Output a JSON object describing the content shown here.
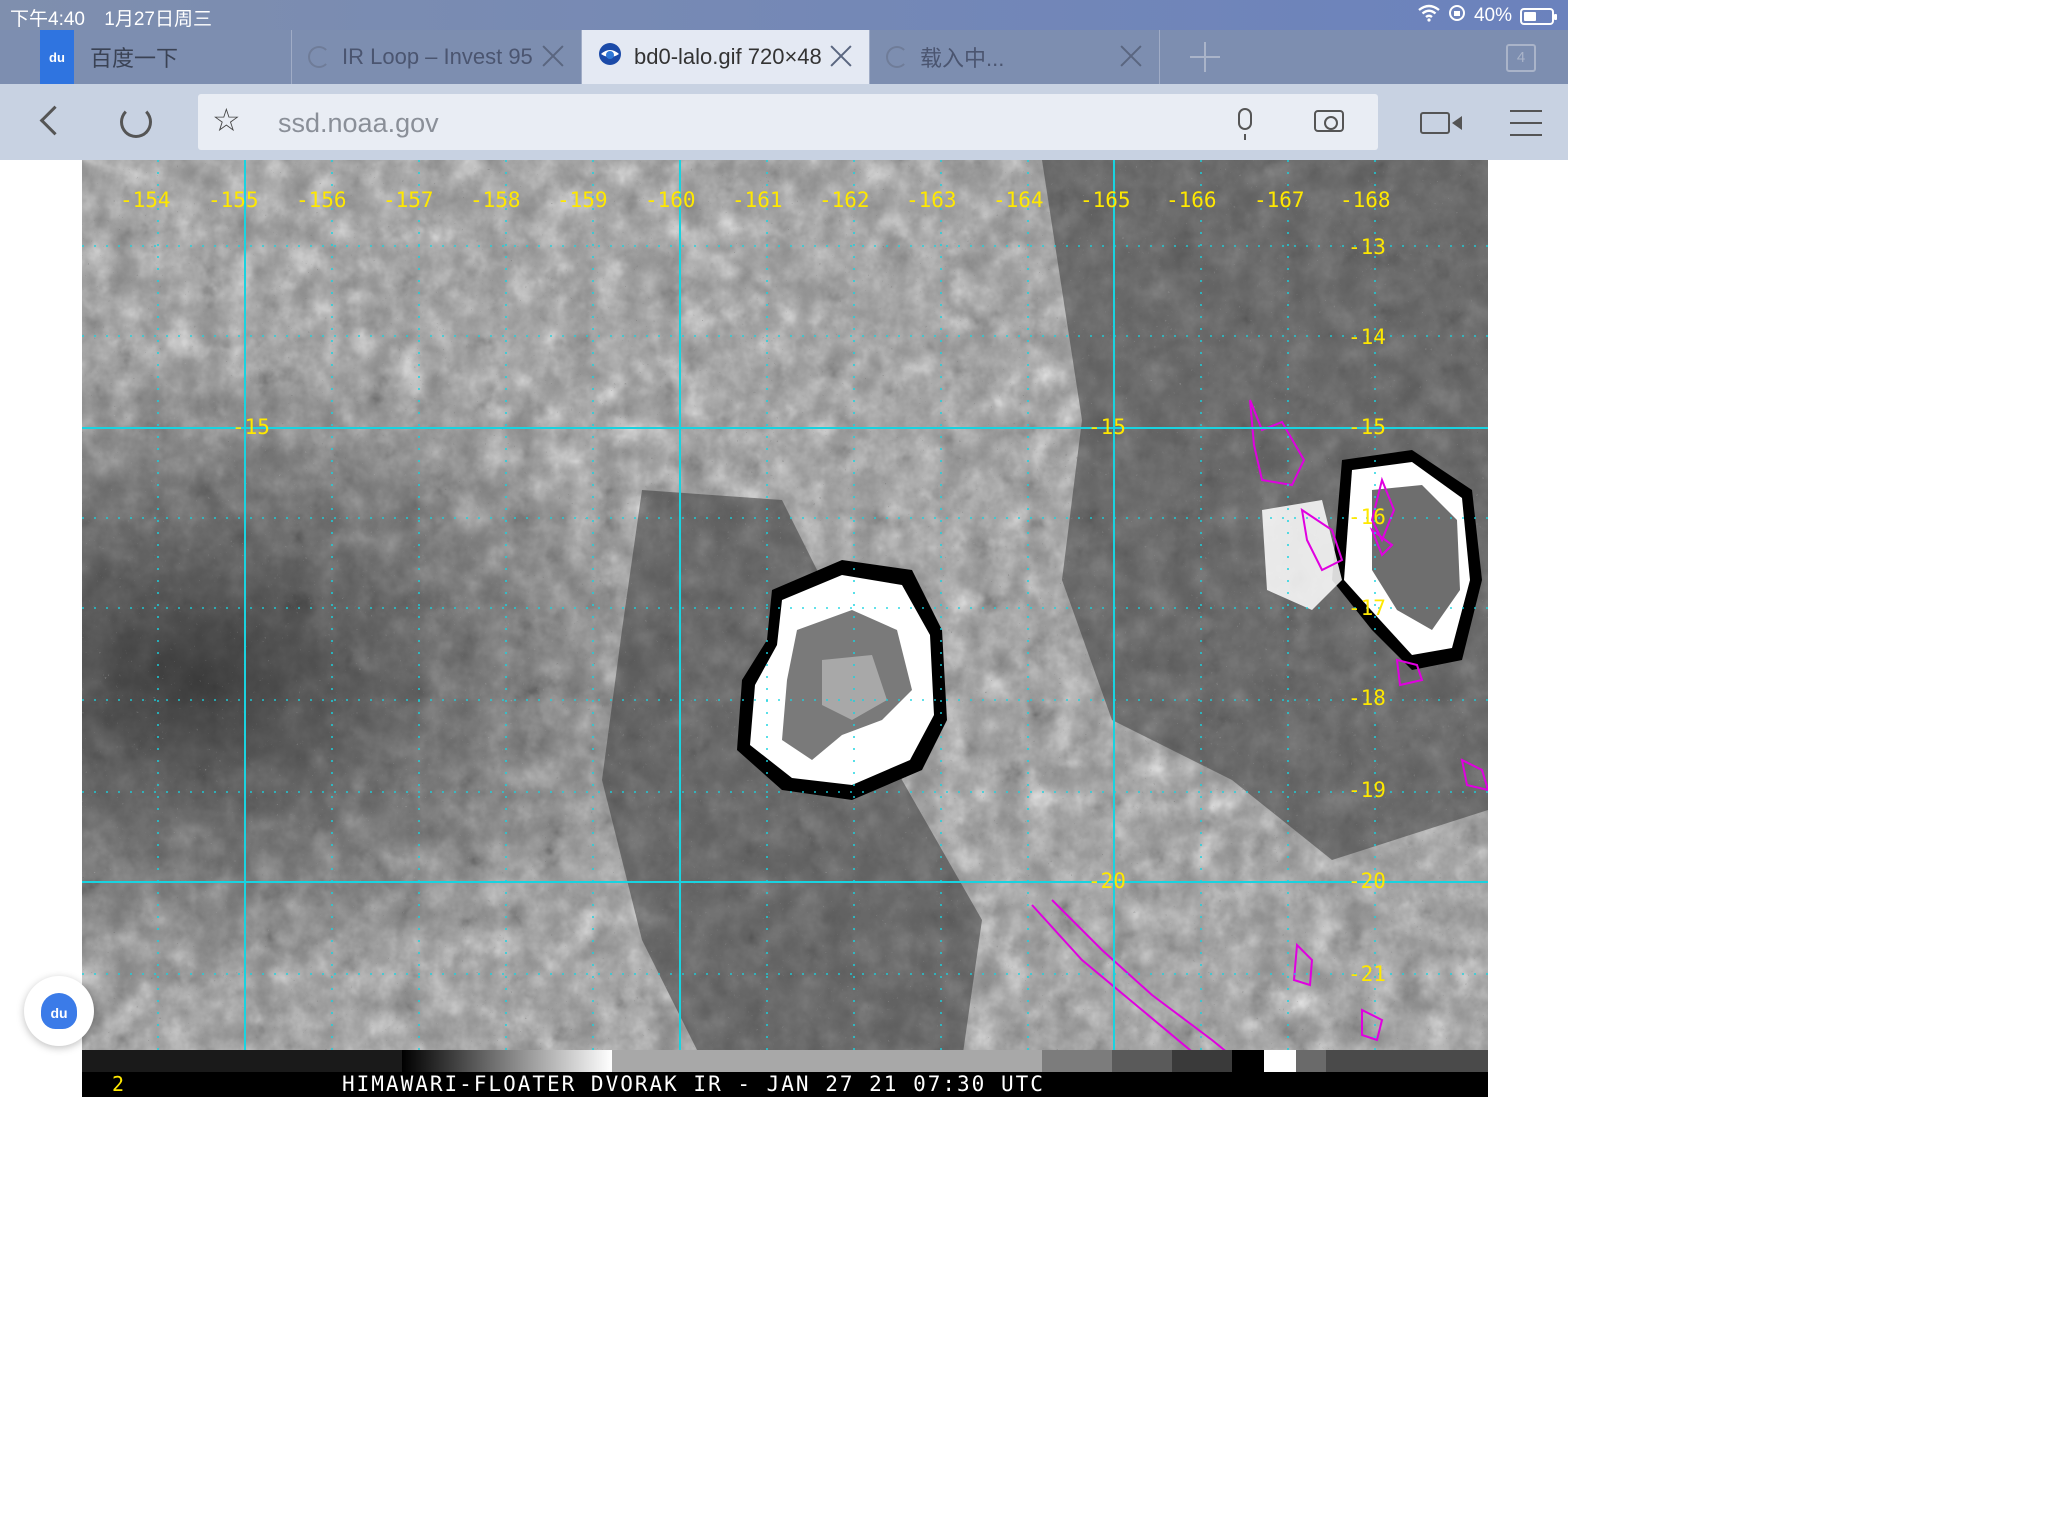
{
  "status_bar": {
    "time": "下午4:40",
    "date": "1月27日周三",
    "battery": "40%",
    "battery_level": 0.4
  },
  "tabs": [
    {
      "title": "百度一下",
      "icon": "baidu-icon",
      "state": "loaded"
    },
    {
      "title": "IR Loop – Invest 95",
      "icon": "loading-spinner-icon",
      "state": "loading"
    },
    {
      "title": "bd0-lalo.gif 720×48",
      "icon": "noaa-icon",
      "state": "active"
    },
    {
      "title": "载入中...",
      "icon": "loading-spinner-icon",
      "state": "loading"
    }
  ],
  "tab_count": "4",
  "toolbar": {
    "url": "ssd.noaa.gov"
  },
  "satellite": {
    "longitude_labels": [
      "-154",
      "-155",
      "-156",
      "-157",
      "-158",
      "-159",
      "-160",
      "-161",
      "-162",
      "-163",
      "-164",
      "-165",
      "-166",
      "-167",
      "-168"
    ],
    "latitude_labels": [
      "-13",
      "-14",
      "-15",
      "-16",
      "-17",
      "-18",
      "-19",
      "-20",
      "-21"
    ],
    "inner_lat_labels": [
      "-15",
      "-15",
      "-20"
    ],
    "frame_number": "2",
    "caption": "HIMAWARI-FLOATER DVORAK IR - JAN 27 21 07:30 UTC",
    "colors": {
      "grid": "#19d3e0",
      "labels": "#ffe800",
      "coastline": "#e000e0"
    }
  }
}
